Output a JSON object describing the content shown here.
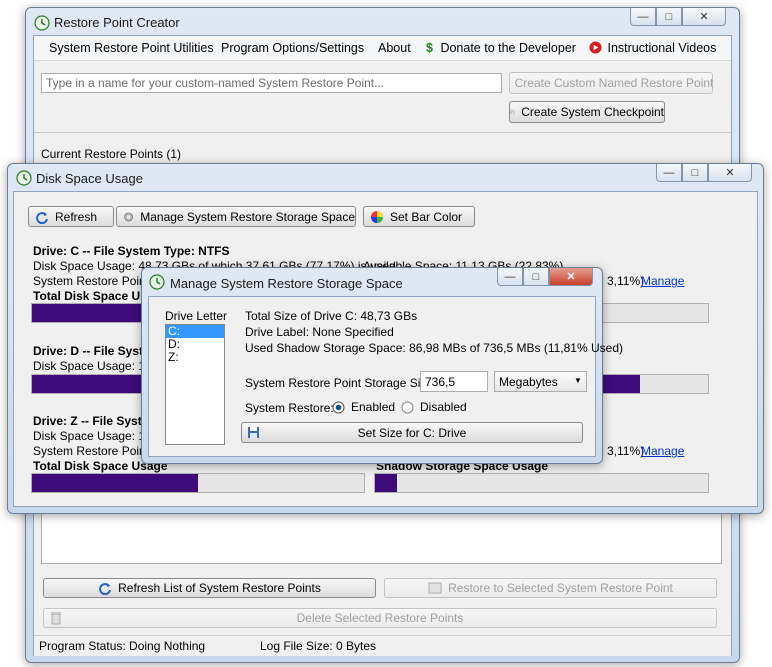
{
  "main_window": {
    "title": "Restore Point Creator",
    "menu": {
      "utilities": "System Restore Point Utilities",
      "options": "Program Options/Settings",
      "about": "About",
      "donate": "Donate to the Developer",
      "videos": "Instructional Videos"
    },
    "name_input_placeholder": "Type in a name for your custom-named System Restore Point...",
    "create_custom_label": "Create Custom Named Restore Point",
    "create_checkpoint_label": "Create System Checkpoint",
    "current_points_label": "Current Restore Points (1)",
    "refresh_list_label": "Refresh List of System Restore Points",
    "restore_selected_label": "Restore to Selected System Restore Point",
    "delete_selected_label": "Delete Selected Restore Points",
    "status": {
      "program_status": "Program Status:  Doing Nothing",
      "log_size": "Log File Size:  0 Bytes"
    }
  },
  "disk_window": {
    "title": "Disk Space Usage",
    "refresh_label": "Refresh",
    "manage_label": "Manage System Restore Storage Space",
    "bar_color_label": "Set Bar Color",
    "drives": [
      {
        "header": "Drive: C -- File System Type: NTFS",
        "usage": "Disk Space Usage: 48,73 GBs of which 37,61 GBs (77,17%) is used",
        "available": "Available Space: 11,13 GBs (22,83%)",
        "restore_label": "System Restore Point M",
        "restore_pct": "3,11%)",
        "manage_link": "Manage",
        "total_label": "Total Disk Space U",
        "total_fraction": 0.7717
      },
      {
        "header": "Drive: D -- File Syst",
        "usage": "Disk Space Usage: 10",
        "total_fraction": 0.9
      },
      {
        "header": "Drive: Z -- File Syst",
        "usage": "Disk Space Usage: 10",
        "restore_label": "System Restore Point M",
        "restore_pct": "3,11%)",
        "manage_link": "Manage",
        "total_label": "Total Disk Space Usage",
        "shadow_label": "Shadow Storage Space Usage",
        "total_fraction": 0.5,
        "shadow_fraction": 0.0667
      }
    ]
  },
  "manage_dialog": {
    "title": "Manage System Restore Storage Space",
    "drive_letter_label": "Drive Letter",
    "drive_list": [
      "C:",
      "D:",
      "Z:"
    ],
    "total_size": "Total Size of Drive C: 48,73 GBs",
    "drive_label": "Drive Label: None Specified",
    "used_shadow": "Used Shadow Storage Space: 86,98 MBs of 736,5 MBs (11,81% Used)",
    "storage_size_label": "System Restore Point Storage Size:",
    "storage_size_value": "736,5",
    "unit_selected": "Megabytes",
    "system_restore_label": "System Restore:",
    "enabled_label": "Enabled",
    "disabled_label": "Disabled",
    "restore_enabled": true,
    "set_size_label": "Set Size for C: Drive"
  }
}
